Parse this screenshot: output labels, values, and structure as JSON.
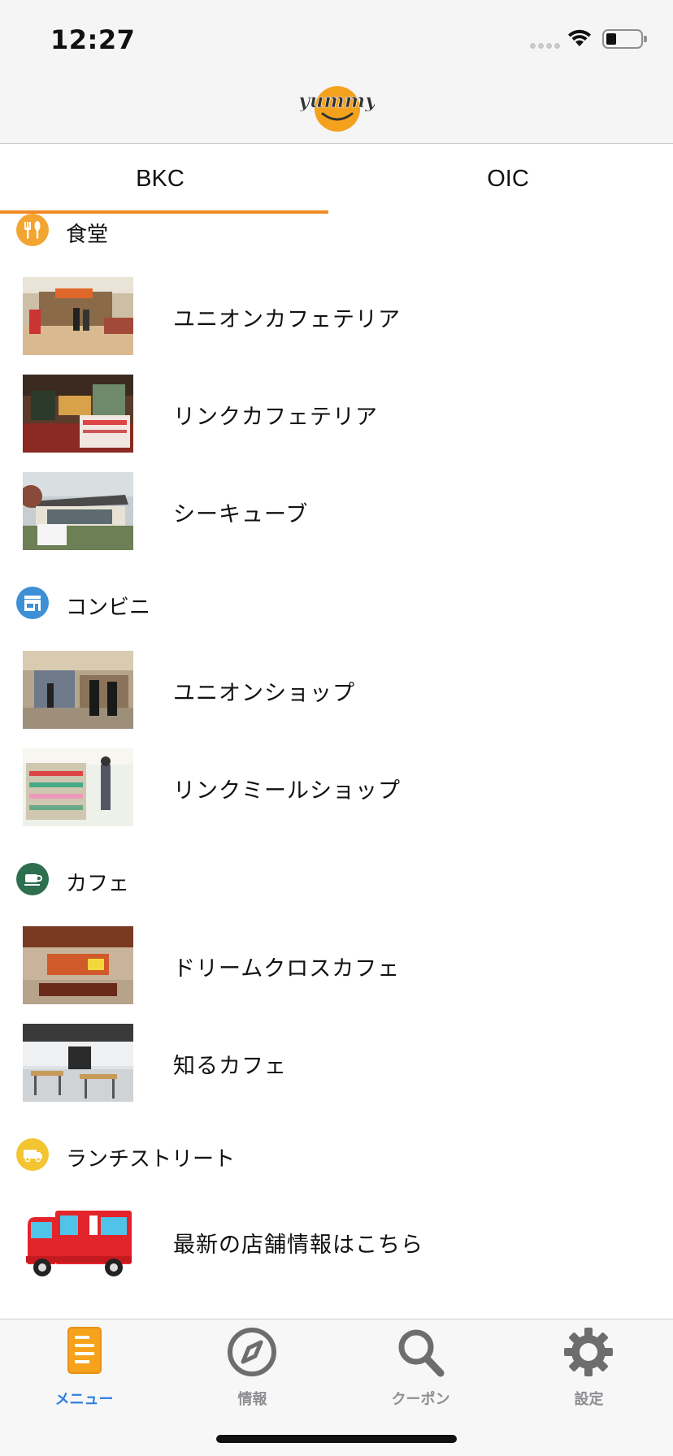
{
  "status": {
    "time": "12:27"
  },
  "nav": {
    "logo_text": "yummy"
  },
  "segments": [
    {
      "label": "BKC",
      "selected": true
    },
    {
      "label": "OIC",
      "selected": false
    }
  ],
  "accent_color": "#f08a24",
  "sections": [
    {
      "title": "食堂",
      "icon": "fork-knife-icon",
      "icon_color": "#f2a531",
      "items": [
        {
          "label": "ユニオンカフェテリア"
        },
        {
          "label": "リンクカフェテリア"
        },
        {
          "label": "シーキューブ"
        }
      ]
    },
    {
      "title": "コンビニ",
      "icon": "store-icon",
      "icon_color": "#3d8fd6",
      "items": [
        {
          "label": "ユニオンショップ"
        },
        {
          "label": "リンクミールショップ"
        }
      ]
    },
    {
      "title": "カフェ",
      "icon": "coffee-cup-icon",
      "icon_color": "#2e6f4f",
      "items": [
        {
          "label": "ドリームクロスカフェ"
        },
        {
          "label": "知るカフェ"
        }
      ]
    },
    {
      "title": "ランチストリート",
      "icon": "food-truck-icon",
      "icon_color": "#f2c531",
      "items": [
        {
          "label": "最新の店舗情報はこちら"
        }
      ]
    }
  ],
  "tabbar": {
    "items": [
      {
        "label": "メニュー",
        "icon": "menu-document-icon",
        "active": true
      },
      {
        "label": "情報",
        "icon": "compass-icon",
        "active": false
      },
      {
        "label": "クーポン",
        "icon": "search-icon",
        "active": false
      },
      {
        "label": "設定",
        "icon": "gear-icon",
        "active": false
      }
    ],
    "active_color": "#2f7fe0",
    "inactive_color": "#8e8e93"
  }
}
